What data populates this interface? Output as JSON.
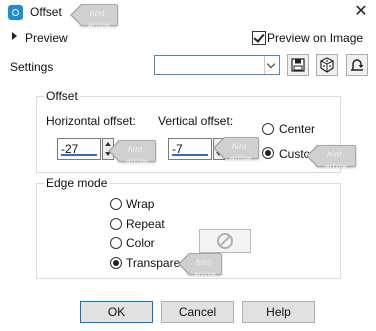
{
  "window": {
    "title": "Offset",
    "close_glyph": "✕"
  },
  "hint_label": "hint-arrow",
  "preview": {
    "label": "Preview",
    "preview_on_image_label": "Preview on Image",
    "preview_on_image_checked": true
  },
  "settings": {
    "label": "Settings",
    "selected_value": ""
  },
  "toolbar": {
    "icons": [
      "save-preset-icon",
      "randomize-icon",
      "reset-icon"
    ]
  },
  "offset": {
    "group_label": "Offset",
    "horizontal_label": "Horizontal offset:",
    "horizontal_value": "-27",
    "vertical_label": "Vertical offset:",
    "vertical_value": "-7",
    "center_label": "Center",
    "custom_label": "Custom",
    "selected": "Custom"
  },
  "edge_mode": {
    "group_label": "Edge mode",
    "options": [
      "Wrap",
      "Repeat",
      "Color",
      "Transparent"
    ],
    "selected": "Transparent"
  },
  "buttons": {
    "ok": "OK",
    "cancel": "Cancel",
    "help": "Help"
  }
}
